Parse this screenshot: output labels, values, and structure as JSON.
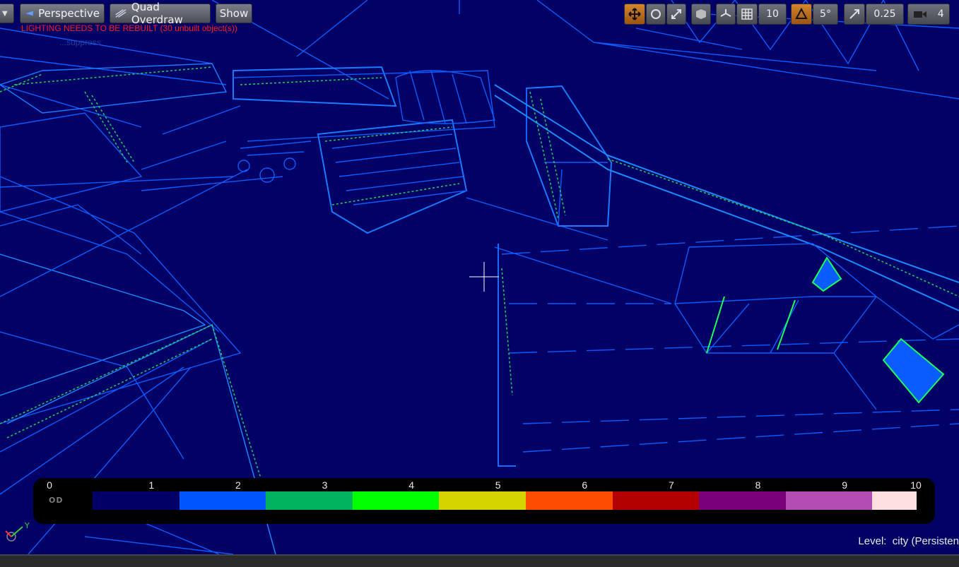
{
  "toolbar": {
    "view_mode": "Perspective",
    "shading_mode": "Quad Overdraw",
    "show_label": "Show",
    "grid_snap_value": "10",
    "rotation_snap_value": "5°",
    "scale_snap_value": "0.25",
    "camera_speed_value": "4"
  },
  "messages": {
    "warning": "LIGHTING NEEDS TO BE REBUILT (30 unbuilt object(s))",
    "suppress": "...suppress"
  },
  "legend": {
    "label": "OD",
    "ticks": [
      "0",
      "1",
      "2",
      "3",
      "4",
      "5",
      "6",
      "7",
      "8",
      "9",
      "10"
    ],
    "colors": [
      "#000066",
      "#0055ff",
      "#00b35e",
      "#00ff00",
      "#d4d400",
      "#ff4d00",
      "#b30000",
      "#7a007a",
      "#b34db3",
      "#ffe0e0"
    ]
  },
  "status": {
    "level_label": "Level:",
    "level_value": "city (Persisten"
  },
  "axis": {
    "y_label": "Y"
  }
}
